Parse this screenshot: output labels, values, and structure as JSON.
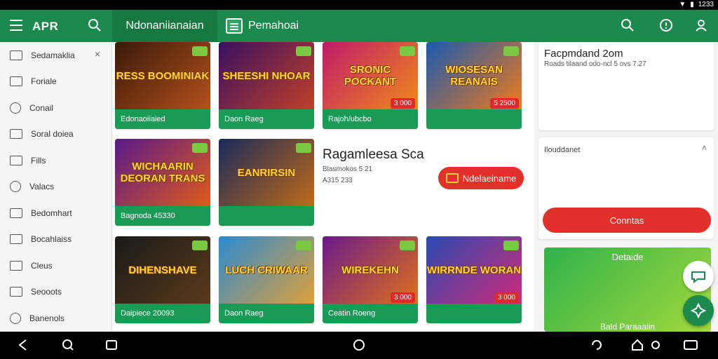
{
  "status_bar": {
    "time": "1233"
  },
  "app_bar": {
    "app_name": "APR",
    "tab_active": "Ndonaniianaian",
    "tab_second": "Pemahoai"
  },
  "sidebar": {
    "items": [
      {
        "label": "Sedamaklia",
        "icon": "box-icon"
      },
      {
        "label": "Foriale",
        "icon": "image-icon"
      },
      {
        "label": "Conail",
        "icon": "info-circle-icon"
      },
      {
        "label": "Soral doiea",
        "icon": "edit-icon"
      },
      {
        "label": "Fills",
        "icon": "calendar-icon"
      },
      {
        "label": "Valacs",
        "icon": "circle-icon"
      },
      {
        "label": "Bedomhart",
        "icon": "page-icon"
      },
      {
        "label": "Bocahlaiss",
        "icon": "layers-icon"
      },
      {
        "label": "Cleus",
        "icon": "document-icon"
      },
      {
        "label": "Seooots",
        "icon": "people-icon"
      },
      {
        "label": "Banenols",
        "icon": "circle-icon"
      }
    ]
  },
  "cards": [
    {
      "art": "RESS BOOMINIAK",
      "caption": "Edonaoiiaied",
      "price": ""
    },
    {
      "art": "SHEESHI NHOAR",
      "caption": "Daon Raeg",
      "price": ""
    },
    {
      "art": "SRONIC POCKANT",
      "caption": "Rajoh/ubcbo",
      "price": "3 000"
    },
    {
      "art": "WIOSESAN REANAIS",
      "caption": "",
      "price": "5 2500"
    },
    {
      "art": "WICHAARIN DEORAN TRANS",
      "caption": "Bagnoda 45330",
      "price": ""
    },
    {
      "art": "EANRIRSIN",
      "caption": "",
      "price": ""
    },
    {
      "art": "DIHENSHAVE",
      "caption": "Daipiece 20093",
      "price": ""
    },
    {
      "art": "LUCH CRIWAAR",
      "caption": "Daon Raeg",
      "price": ""
    },
    {
      "art": "WIREKEHN",
      "caption": "Ceatin Roeng",
      "price": "3 000"
    },
    {
      "art": "WIRRNDE WORAN",
      "caption": "",
      "price": "3 000"
    }
  ],
  "promo": {
    "title": "Ragamleesa Sca",
    "line1": "Blasmokos 5 21",
    "line2": "A315 233",
    "button": "Ndelaeiname"
  },
  "right_panel": {
    "card1_title": "Facpmdand 2om",
    "card1_sub": "Roads tilaand odo-ncl 5 ovs 7.27",
    "card2_title": "Ilouddanet",
    "card2_button": "Conntas",
    "green_title": "Detaide",
    "green_bottom": "Bald Paraaaiin"
  },
  "colors": {
    "brand_green": "#1c8a4c",
    "accent_red": "#e2312a"
  }
}
